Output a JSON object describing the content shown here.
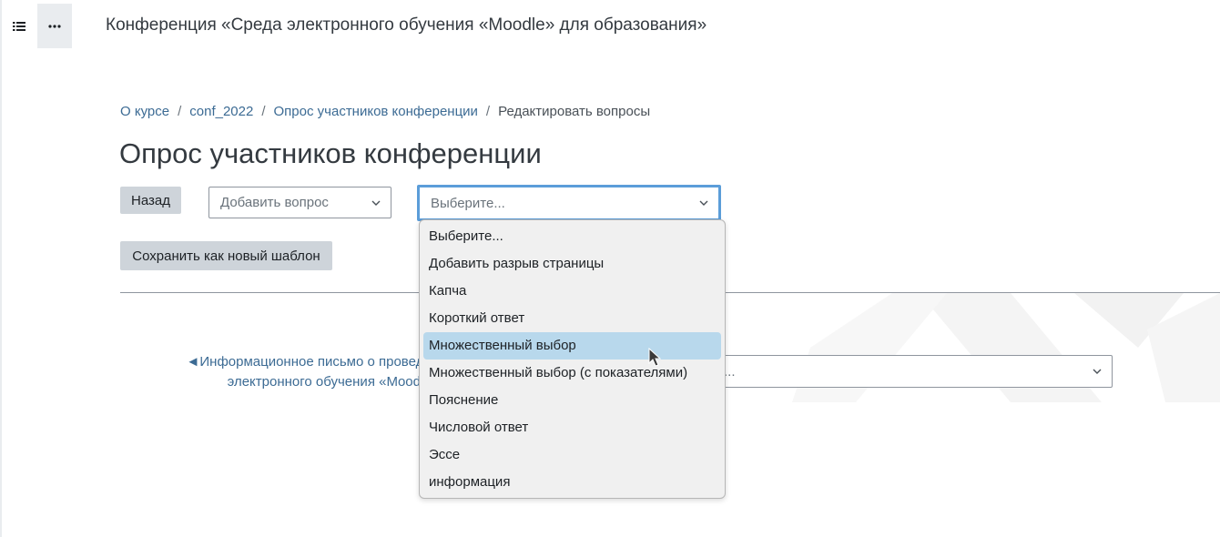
{
  "header": {
    "site_title": "Конференция «Среда электронного обучения «Moodle» для образования»",
    "icons": [
      "list-icon",
      "more-icon"
    ]
  },
  "breadcrumb": {
    "items": [
      "О курсе",
      "conf_2022",
      "Опрос участников конференции"
    ],
    "current": "Редактировать вопросы",
    "separator": "/"
  },
  "page": {
    "heading": "Опрос участников конференции"
  },
  "toolbar": {
    "back_label": "Назад",
    "add_question_placeholder": "Добавить вопрос",
    "type_select_value": "Выберите...",
    "save_template_label": "Сохранить как новый шаблон"
  },
  "dropdown": {
    "options": [
      "Выберите...",
      "Добавить разрыв страницы",
      "Капча",
      "Короткий ответ",
      "Множественный выбор",
      "Множественный выбор (с показателями)",
      "Пояснение",
      "Числовой ответ",
      "Эссе",
      "информация"
    ],
    "highlighted": "Множественный выбор"
  },
  "navigation": {
    "prev_arrow": "◄",
    "prev_link_line1": "Информационное письмо о проведен",
    "prev_link_line2": "электронного обучения «Moodle»",
    "jump_select_value": "..."
  },
  "colors": {
    "link": "#3c6b94",
    "button_bg": "#ced4da",
    "focus_border": "#5b9dd9",
    "highlight": "#b8d8ec"
  }
}
